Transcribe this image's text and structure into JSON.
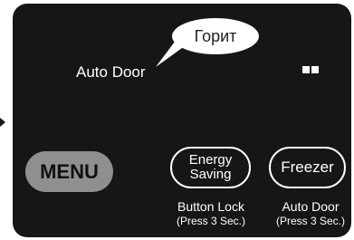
{
  "bubble": {
    "text": "Горит"
  },
  "display": {
    "auto_door_label": "Auto Door"
  },
  "buttons": {
    "menu": "MENU",
    "energy_line1": "Energy",
    "energy_line2": "Saving",
    "freezer": "Freezer"
  },
  "captions": {
    "button_lock": "Button Lock",
    "button_lock_sub": "(Press 3 Sec.)",
    "auto_door": "Auto Door",
    "auto_door_sub": "(Press 3 Sec.)"
  },
  "colors": {
    "panel": "#161616",
    "menu_button": "#8f8f8f",
    "text": "#ffffff"
  }
}
